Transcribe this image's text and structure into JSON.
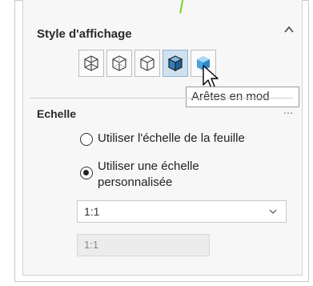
{
  "display_style": {
    "title": "Style d'affichage",
    "collapse_icon": "chevron-up",
    "buttons": [
      {
        "name": "wireframe",
        "icon": "cube-wireframe-icon",
        "active": false
      },
      {
        "name": "hidden-lines-visible",
        "icon": "cube-hidden-lines-visible-icon",
        "active": false
      },
      {
        "name": "hidden-lines-removed",
        "icon": "cube-hidden-lines-removed-icon",
        "active": false
      },
      {
        "name": "shaded-with-edges",
        "icon": "cube-shaded-edges-icon",
        "active": true
      },
      {
        "name": "shaded",
        "icon": "cube-shaded-icon",
        "active": false
      }
    ],
    "tooltip": "Arêtes en mod"
  },
  "scale": {
    "title": "Echelle",
    "options": [
      {
        "label": "Utiliser l'échelle de la feuille",
        "checked": false
      },
      {
        "label_line1": "Utiliser une échelle",
        "label_line2": "personnalisée",
        "checked": true
      }
    ],
    "select_value": "1:1",
    "custom_value": "1:1"
  },
  "colors": {
    "accent_blue": "#4aa3df",
    "active_button": "#cfe0ef"
  }
}
